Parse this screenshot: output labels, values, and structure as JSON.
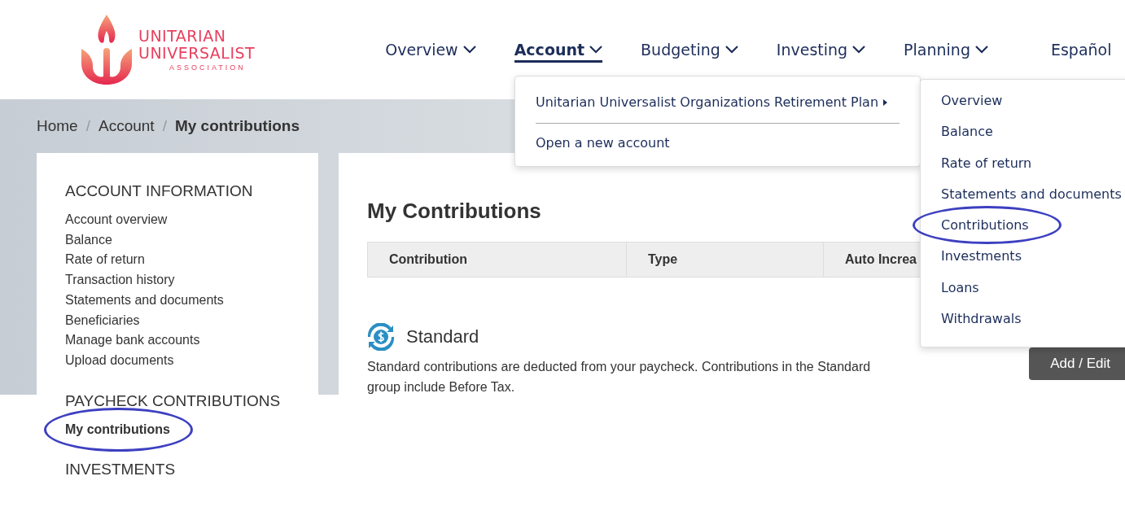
{
  "logo": {
    "lines": [
      "UNITARIAN",
      "UNIVERSALIST"
    ],
    "subline": "ASSOCIATION"
  },
  "nav": [
    {
      "label": "Overview",
      "selected": false,
      "has_menu": true
    },
    {
      "label": "Account",
      "selected": true,
      "has_menu": true
    },
    {
      "label": "Budgeting",
      "selected": false,
      "has_menu": true
    },
    {
      "label": "Investing",
      "selected": false,
      "has_menu": true
    },
    {
      "label": "Planning",
      "selected": false,
      "has_menu": true
    },
    {
      "label": "Español",
      "selected": false,
      "has_menu": false
    }
  ],
  "account_menu": {
    "plan": "Unitarian Universalist Organizations Retirement Plan",
    "action": "Open a new account"
  },
  "plan_submenu": [
    {
      "label": "Overview",
      "circled": false
    },
    {
      "label": "Balance",
      "circled": false
    },
    {
      "label": "Rate of return",
      "circled": false
    },
    {
      "label": "Statements and documents",
      "circled": false
    },
    {
      "label": "Contributions",
      "circled": true
    },
    {
      "label": "Investments",
      "circled": false
    },
    {
      "label": "Loans",
      "circled": false
    },
    {
      "label": "Withdrawals",
      "circled": false
    }
  ],
  "breadcrumb_separator": "/",
  "breadcrumb": [
    {
      "label": "Home",
      "current": false
    },
    {
      "label": "Account",
      "current": false
    },
    {
      "label": "My contributions",
      "current": true
    }
  ],
  "sidebar": [
    {
      "heading": "ACCOUNT INFORMATION",
      "items": [
        {
          "label": "Account overview",
          "selected": false,
          "circled": false
        },
        {
          "label": "Balance",
          "selected": false,
          "circled": false
        },
        {
          "label": "Rate of return",
          "selected": false,
          "circled": false
        },
        {
          "label": "Transaction history",
          "selected": false,
          "circled": false
        },
        {
          "label": "Statements and documents",
          "selected": false,
          "circled": false
        },
        {
          "label": "Beneficiaries",
          "selected": false,
          "circled": false
        },
        {
          "label": "Manage bank accounts",
          "selected": false,
          "circled": false
        },
        {
          "label": "Upload documents",
          "selected": false,
          "circled": false
        }
      ]
    },
    {
      "heading": "PAYCHECK CONTRIBUTIONS",
      "items": [
        {
          "label": "My contributions",
          "selected": true,
          "circled": true
        }
      ]
    },
    {
      "heading": "INVESTMENTS"
    }
  ],
  "main": {
    "title": "My Contributions",
    "table": {
      "columns": [
        "Contribution",
        "Type",
        "Auto Increa"
      ]
    },
    "group": {
      "name": "Standard",
      "description": "Standard contributions are deducted from your paycheck. Contributions in the Standard group include Before Tax.",
      "button": "Add / Edit"
    }
  }
}
